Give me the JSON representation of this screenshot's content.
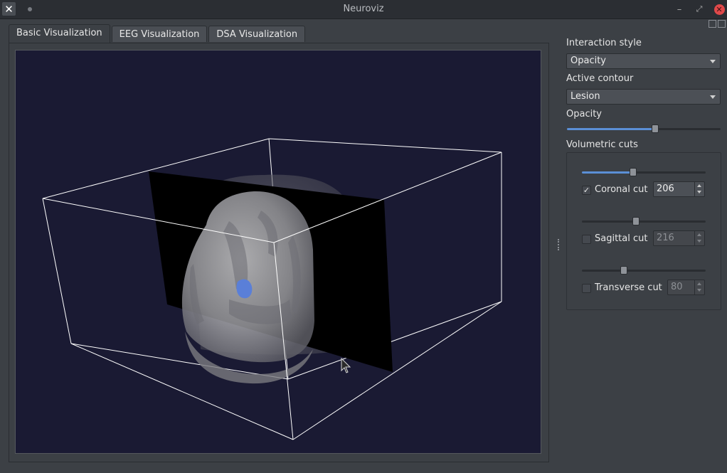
{
  "window": {
    "title": "Neuroviz",
    "app_icon": "x-logo-icon",
    "close_symbol": "✕",
    "minimize_symbol": "–",
    "maximize_symbol": "⤢"
  },
  "tabs": [
    {
      "label": "Basic Visualization",
      "active": true
    },
    {
      "label": "EEG Visualization",
      "active": false
    },
    {
      "label": "DSA Visualization",
      "active": false
    }
  ],
  "panel": {
    "interaction_style": {
      "label": "Interaction style",
      "value": "Opacity"
    },
    "active_contour": {
      "label": "Active contour",
      "value": "Lesion"
    },
    "opacity": {
      "label": "Opacity",
      "value_fraction": 0.58
    },
    "volumetric_cuts": {
      "label": "Volumetric cuts",
      "coronal": {
        "label": "Coronal cut",
        "checked": true,
        "value": "206",
        "slider_fraction": 0.41,
        "check_symbol": "✓"
      },
      "sagittal": {
        "label": "Sagittal cut",
        "checked": false,
        "value": "216",
        "slider_fraction": 0.43
      },
      "transverse": {
        "label": "Transverse cut",
        "checked": false,
        "value": "80",
        "slider_fraction": 0.33
      }
    }
  },
  "colors": {
    "viewport_bg": "#1a1a33",
    "accent": "#5b8fd6",
    "close_button": "#e0494a",
    "lesion": "#5a7fd8"
  }
}
